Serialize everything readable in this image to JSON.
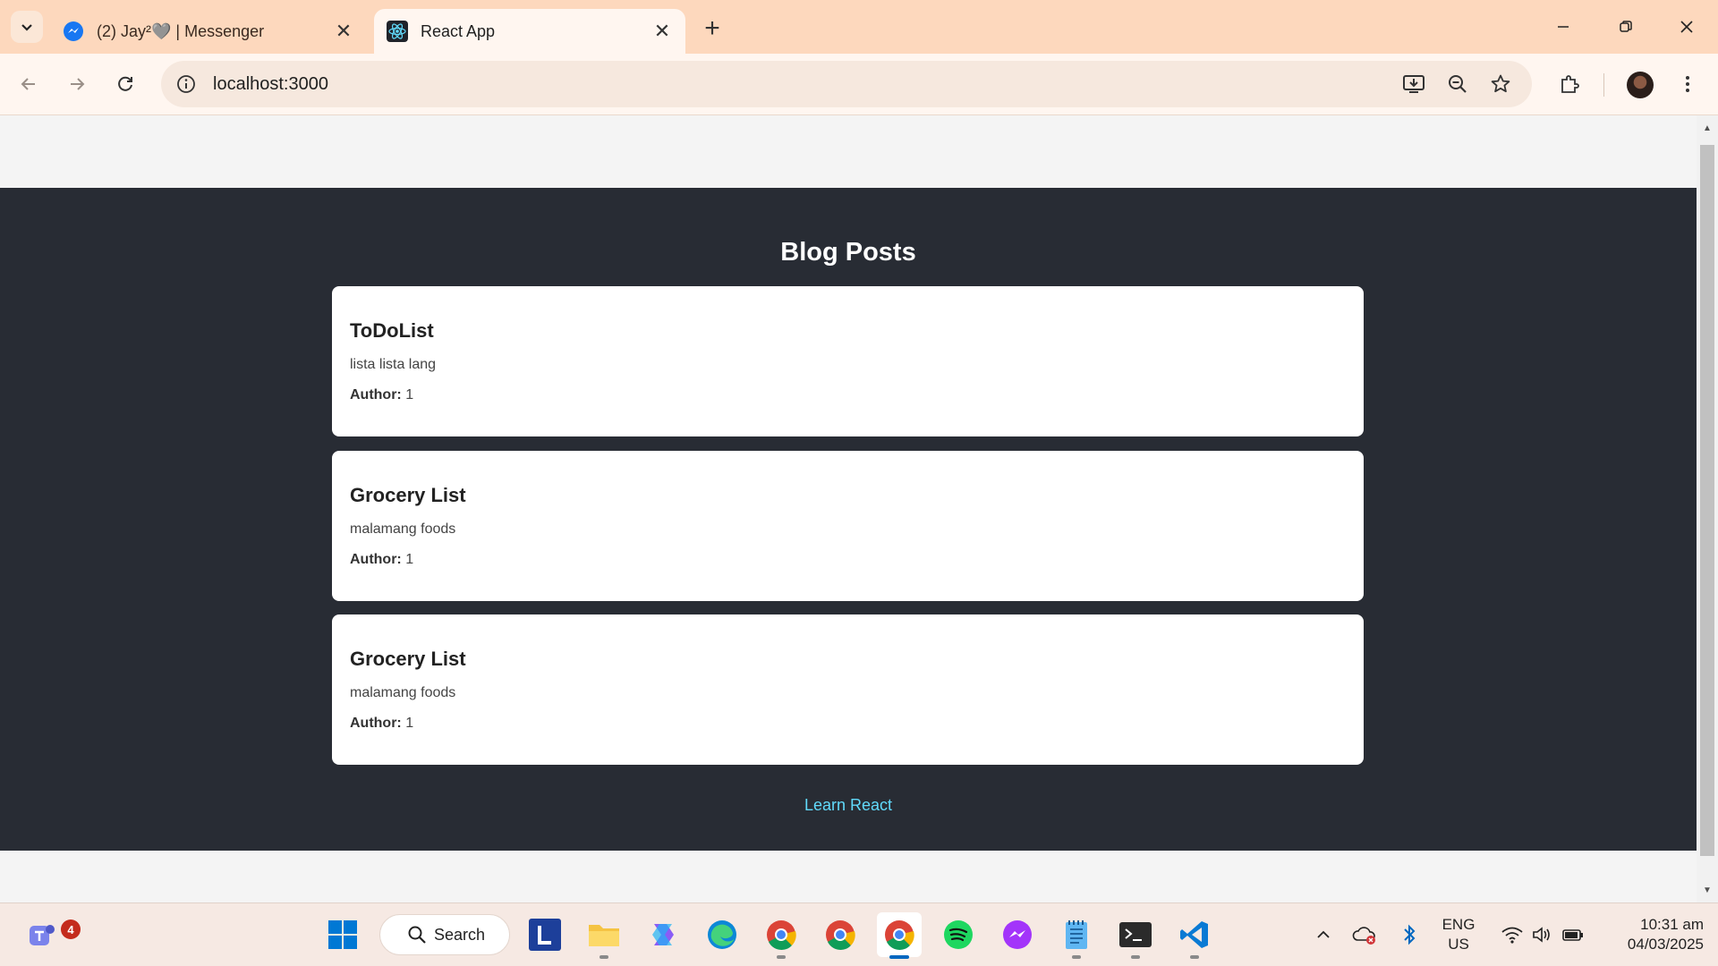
{
  "browser": {
    "tabs": [
      {
        "title": "(2) Jay²🩶 | Messenger",
        "active": false,
        "favicon": "messenger-icon"
      },
      {
        "title": "React App",
        "active": true,
        "favicon": "react-icon"
      }
    ],
    "address": "localhost:3000"
  },
  "page": {
    "heading": "Blog Posts",
    "posts": [
      {
        "title": "ToDoList",
        "body": "lista lista lang",
        "author_label": "Author:",
        "author": "1"
      },
      {
        "title": "Grocery List",
        "body": "malamang foods",
        "author_label": "Author:",
        "author": "1"
      },
      {
        "title": "Grocery List",
        "body": "malamang foods",
        "author_label": "Author:",
        "author": "1"
      }
    ],
    "link": "Learn React"
  },
  "taskbar": {
    "search_label": "Search",
    "notification_count": "4",
    "language": {
      "line1": "ENG",
      "line2": "US"
    },
    "time": "10:31 am",
    "date": "04/03/2025"
  },
  "colors": {
    "app_bg": "#282c34",
    "link": "#61dafb",
    "tabstrip": "#fdd8bd"
  }
}
